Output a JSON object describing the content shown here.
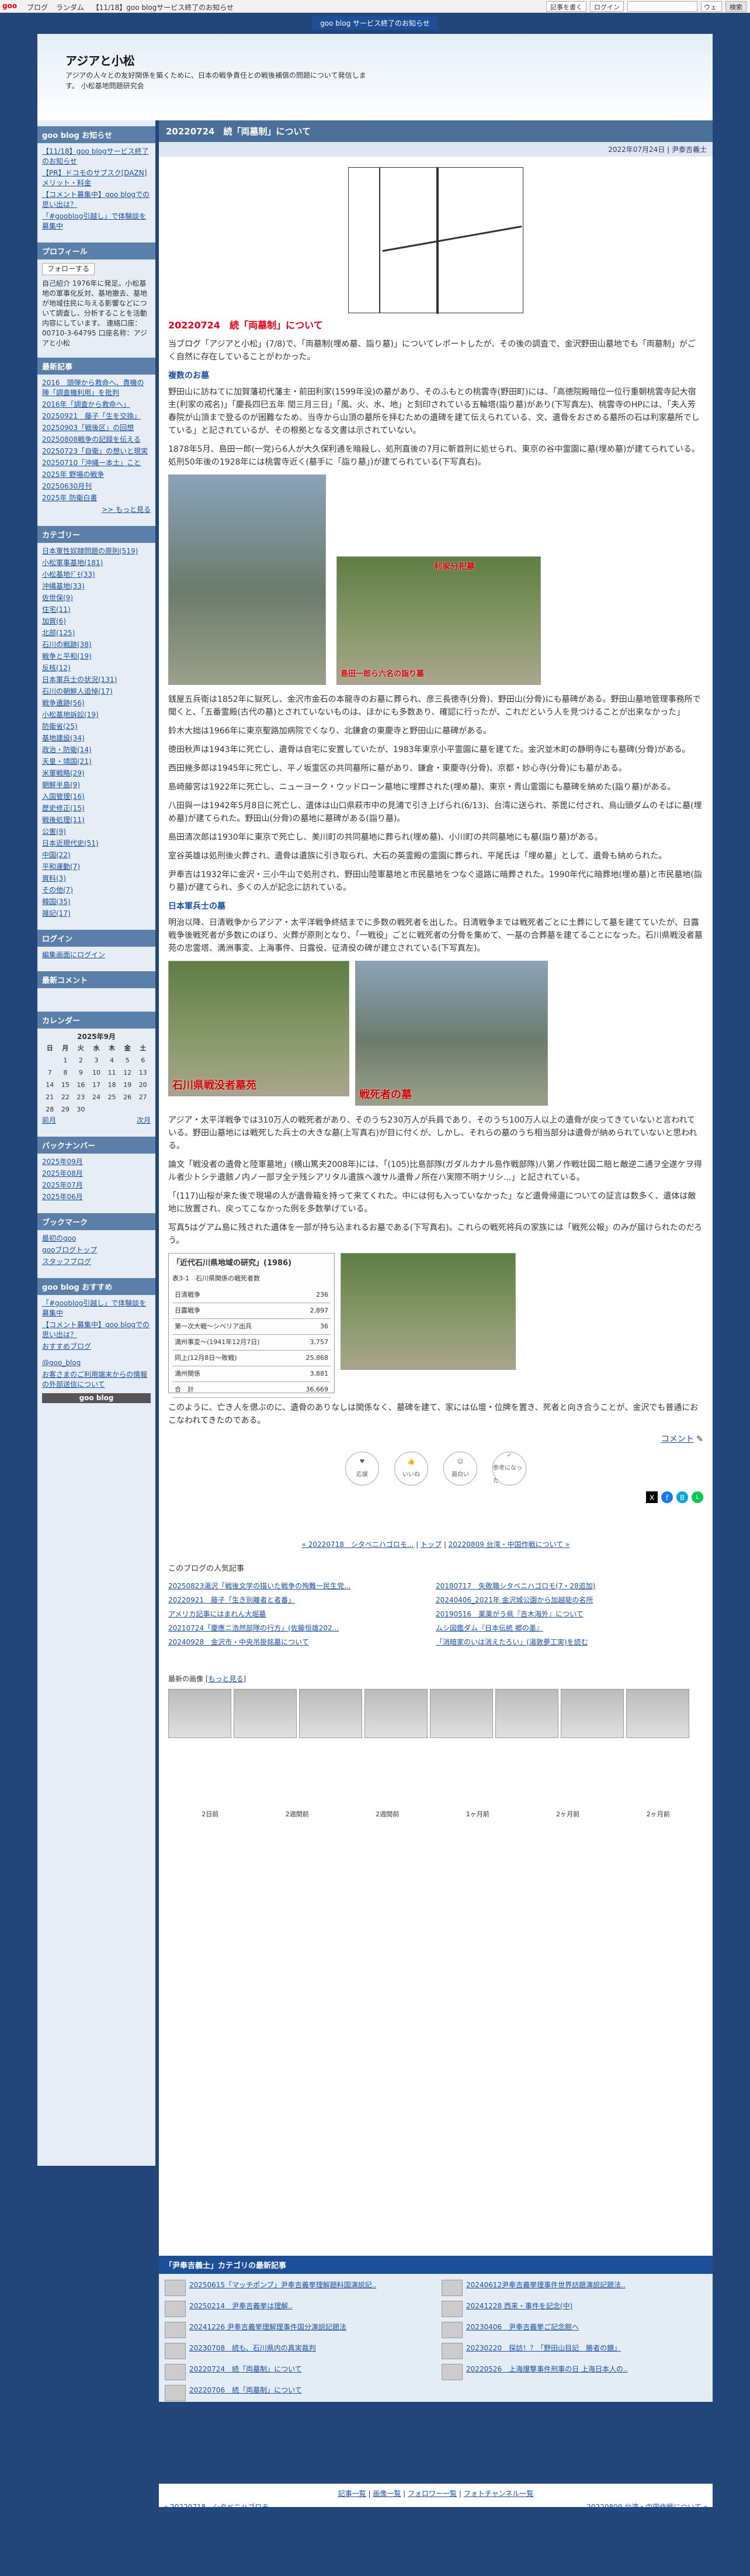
{
  "topbar": {
    "logo": "goo",
    "links": [
      "ブログ",
      "ランダム",
      "【11/18】goo blogサービス終了のお知らせ"
    ],
    "login": "記事を書く",
    "login2": "ログイン",
    "scope": "ウェブ",
    "search_btn": "検索"
  },
  "notice": {
    "text": "goo blog サービス終了のお知らせ"
  },
  "header": {
    "title": "アジアと小松",
    "desc": "アジアの人々との友好関係を築くために、日本の戦争責任との戦後補償の問題について発信します。 小松基地問題研究会"
  },
  "sidebar": {
    "news_head": "goo blog お知らせ",
    "news": [
      "【11/18】goo blogサービス終了のお知らせ",
      "【PR】ドコモのサブスク[DAZN] メリット・料金",
      "【コメント募集中】goo blogでの思い出は？",
      "「#gooblog引越し」で体験談を募集中"
    ],
    "profile_head": "プロフィール",
    "follow": "フォローする",
    "profile": "自己紹介 1976年に発足。小松基地の軍事化反対、基地撤去、基地が地域住民に与える影響などについて調査し、分析することを活動内容にしています。 連絡口座：00710-3-64795 口座名称：アジアと小松",
    "recent_head": "最新記事",
    "recent": [
      "2016　頭弾から救命へ、貴機の陣「調査機利用」を批判",
      "2016年「調査から救命へ」",
      "20250921　藤子「生を交換」",
      "20250903「戦後区」の回想",
      "20250808戦争の記録を伝える",
      "20250723「自衛」の想いと現実",
      "20250710「沖縄ー本土」こと",
      "2025年 野場の戦争",
      "20250630月刊",
      "2025年 防衛白書"
    ],
    "recent_more": ">> もっと見る",
    "cat_head": "カテゴリー",
    "cats": [
      "日本軍性奴隷問題の原則(519)",
      "小松軍事基地(181)",
      "小松基地ﾃﾞﾓ(33)",
      "沖縄基地(33)",
      "佐世保(9)",
      "住宅(11)",
      "加賀(6)",
      "北部(125)",
      "石川の戦跡(38)",
      "戦争と平和(19)",
      "反核(12)",
      "日本軍兵士の状況(131)",
      "石川の朝鮮人追悼(17)",
      "戦争遺跡(56)",
      "小松基地訴訟(19)",
      "防衛省(25)",
      "基地建設(34)",
      "政治・防衛(14)",
      "天皇・靖国(21)",
      "米軍戦略(29)",
      "朝鮮半島(9)",
      "入国管理(16)",
      "歴史修正(15)",
      "戦後処理(11)",
      "公害(9)",
      "日本近現代史(51)",
      "中国(22)",
      "平和運動(7)",
      "資料(3)",
      "その他(7)",
      "韓国(35)",
      "雑記(17)"
    ],
    "login_head": "ログイン",
    "login_link": "編集画面にログイン",
    "comments_head": "最新コメント",
    "cal_head": "カレンダー",
    "cal_month": "2025年9月",
    "cal_days": [
      "日",
      "月",
      "火",
      "水",
      "木",
      "金",
      "土"
    ],
    "cal_prev": "前月",
    "cal_next": "次月",
    "back_head": "バックナンバー",
    "backs": [
      "2025年09月",
      "2025年08月",
      "2025年07月",
      "2025年06月"
    ],
    "bm_head": "ブックマーク",
    "bms": [
      "最初のgoo",
      "gooブログトップ",
      "スタッフブログ"
    ],
    "rec_head": "goo blog おすすめ",
    "recs": [
      "「#gooblog引越し」で体験談を募集中",
      "【コメント募集中】goo blogでの思い出は？",
      "おすすめブログ"
    ],
    "gooid": "@goo_blog",
    "guide": "お客さまのご利用端末からの情報の外部送信について",
    "goo_blog_logo": "goo blog"
  },
  "article": {
    "date_title": "20220724　続「両墓制」について",
    "meta": "2022年07月24日 | 尹泰吉義士",
    "subtitle": "20220724　続「両墓制」について",
    "intro": "当ブログ「アジアと小松」(7/8)で、「両墓制(埋め墓、詣り墓)」についてレポートしたが、その後の調査で、金沢野田山墓地でも「両墓制」がごく自然に存在していることがわかった。",
    "sec1": "複数のお墓",
    "p1": "野田山に訪ねてに加賀藩初代藩主・前田利家(1599年没)の墓があり、そのふもとの桃雲寺(野田町)には、「高徳院殿暗位一位行重朝桃雲寺記大宿主(利家の戒名)」「慶長四巳五年 閏三月三日」「風、火、水、地」と刻印されている五輪塔(詣り墓)があり(下写真左)、桃雲寺のHPには、「夫人芳春院が山頂まで登るのが困難なため、当寺から山頂の墓所を拝むための遺碑を建て伝えられている、文、遺骨をおさめる墓所の石は利家墓所でしている」と記されているが、その根拠となる文書は示されていない。",
    "p1b": "1878年5月、島田一郎(一党)ら6人が大久保利通を暗殺し、処刑直後の7月に斬首刑に処せられ、東京の谷中霊園に墓(埋め墓)が建てられている。処刑50年後の1928年には桃雲寺近く(墓手に「詣り墓」)が建てられている(下写真右)。",
    "photo2_cap": "利家分祀墓",
    "photo3_cap": "島田一郎ら六名の詣り墓",
    "p2": "銭屋五兵衛は1852年に獄死し、金沢市金石の本龍寺のお墓に葬られ、彦三長徳寺(分骨)、野田山(分骨)にも墓碑がある。野田山墓地管理事務所で聞くと、「五番霊殿(古代の墓)とされていないものは、ほかにも多数あり、確認に行ったが、これだという人を見つけることが出来なかった」",
    "p3": "鈴木大拙は1966年に東京聖路加病院でくなり、北鎌倉の東慶寺と野田山に墓碑がある。",
    "p4": "徳田秋声は1943年に死亡し、遺骨は自宅に安置していたが、1983年東京小平霊園に墓を建てた。金沢並木町の静明寺にも墓碑(分骨)がある。",
    "p5": "西田幾多郎は1945年に死亡し、平ノ坂霊区の共同墓所に墓があり、鎌倉・東慶寺(分骨)、京都・妙心寺(分骨)にも墓がある。",
    "p6": "島崎藤宮は1922年に死亡し、ニューヨーク・ウッドローン墓地に埋葬された(埋め墓)、東京・青山霊園にも墓碑を納めた(詣り墓)がある。",
    "p7": "八田與一は1942年5月8日に死亡し、遺体は山口県萩市中の見浦で引き上げられ(6/13)、台湾に送られ、茶毘に付され、烏山頭ダムのそばに墓(埋め墓)が建てられた。野田山(分骨)の墓地に墓碑がある(詣り墓)。",
    "p8": "島田清次郎は1930年に東京で死亡し、美川町の共同墓地に葬られ(埋め墓)、小川町の共同墓地にも墓(詣り墓)がある。",
    "p9": "室谷英雄は処刑後火葬され、遺骨は遺族に引き取られ、大石の英霊殿の霊園に葬られ、平尾氏は「埋め墓」として、遺骨も納められた。",
    "p10": "尹奉吉は1932年に金沢・三小牛山で処刑され、野田山陸軍墓地と市民墓地をつなぐ道路に暗葬された。1990年代に暗葬地(埋め墓)と市民墓地(詣り墓)が建てられ、多くの人が記念に訪れている。",
    "sec2": "日本軍兵士の墓",
    "p11": "明治以降、日清戦争からアジア・太平洋戦争終結までに多数の戦死者を出した。日清戦争までは戦死者ごとに土葬にして墓を建てていたが、日露戦争後戦死者が多数にのぼり、火葬が原則となり、「一戦役」ごとに戦死者の分骨を集めて、一基の合葬墓を建てることになった。石川県戦没者墓苑の忠霊塔、満洲事変、上海事件、日露役、征清役の碑が建立されている(下写真左)。",
    "photo4_cap": "石川県戦没者墓苑",
    "photo5_cap": "戦死者の墓",
    "p12": "アジア・太平洋戦争では310万人の戦死者があり、そのうち230万人が兵員であり、そのうち100万人以上の遺骨が戻ってきていないと言われている。野田山墓地には戦死した兵士の大きな墓(上写真右)が目に付くが、しかし、それらの墓のうち相当部分は遺骨が納められていないと思われる。",
    "p13": "論文「戦没者の遺骨と陸軍墓地」(横山篤夫2008年)には、「(105)比島部隊(ガダルカナル島作戦部隊)八第ノ作戦壮図二賠ヒ敵逆二通ヲ全遂ケヲ得ル者少トシテ遺骸ノ内ノ一部ヲ全テ残シアリタル遺族へ渡サル遺骨ノ所在ハ実際不明ナリシ...」と記されている。",
    "p14": "「(117)山桜が来た後で現場の人が遺骨箱を持って来てくれた。中には何も入っていなかった」など遺骨帰還についての証言は数多く、遺体は敵地に放置され、戻ってこなかった例を多数挙げている。",
    "p15": "写真5はグアム島に残された遺体を一部が持ち込まれるお墓である(下写真右)。これらの戦死将兵の家族には「戦死公報」のみが届けられたのだろう。",
    "book_title": "「近代石川県地域の研究」(1986)",
    "table_head": "表3-1　石川県関係の戦死者数",
    "table_rows": [
      [
        "日清戦争",
        "236"
      ],
      [
        "日露戦争",
        "2,897"
      ],
      [
        "第一次大戦～シベリア出兵",
        "36"
      ],
      [
        "満州事変～(1941年12月7日)",
        "3,757"
      ],
      [
        "同上(12月8日～敗戦)",
        "25,868"
      ],
      [
        "満州関係",
        "3,881"
      ],
      [
        "合　計",
        "36,669"
      ]
    ],
    "p16": "このように、亡き人を偲ぶのに、遺骨のありなしは関係なく、墓碑を建て、家には仏壇・位牌を置き、死者と向き合うことが、金沢でも普通におこなわれてきたのである。",
    "comment_link": "コメント",
    "reactions": [
      "応援",
      "いいね",
      "面白い",
      "参考になった"
    ],
    "prev": "« 20220718　シタベニハゴロモ...",
    "top": "トップ",
    "next": "20220809 台湾・中国作戦について »"
  },
  "popular": {
    "head": "このブログの人気記事",
    "items": [
      [
        "20250823湯沢「戦後文学の描いた戦争の殉難ー民生党..."
      ],
      [
        "20220921　藤子「生き別離者と者番」"
      ],
      [
        "アメリカ記事にはまれん大堀墓"
      ],
      [
        "20210724「慶應ニ浩然部隊の行方」(佐藤恒雄202..."
      ],
      [
        "20240928　金沢市・中央吊掛銘墓について"
      ]
    ],
    "items_r": [
      [
        "20180717　失敗職シタベニハゴロモ(7・28追加)"
      ],
      [
        "20240406_2021年 金沢城公園から加越能の名所"
      ],
      [
        "20190516　薬薬がう県『吉木海外』について"
      ],
      [
        "ムシ図鑑ダム『日本伝統 郷の墨』"
      ],
      [
        "「消暗家のいは消えたろい」(湯敦夢工実)を読む"
      ]
    ]
  },
  "recent_imgs_head": "最新の画像",
  "recent_imgs_more": "[もっと見る]",
  "imgs_ages": [
    "2日前",
    "2週間前",
    "2週間前",
    "1ヶ月前",
    "2ヶ月前",
    "2ヶ月前"
  ],
  "catbox": {
    "head": "「尹奉吉義士」カテゴリの最新記事",
    "items": [
      "20250615「マッチポンプ」尹奉吉義挙理解題料国演説記..",
      "20240612尹奉吉義挙理事件世界訪題演説記題法..",
      "20250214　尹奉吉義挙は理解..",
      "20241228 西来・事件を記念(中)",
      "20241226 尹奉吉義挙理解理事件国分演説記題法",
      "20230406　尹奉吉義挙ご記念館へ",
      "20230708　続も、石川県内の真実裁判",
      "20230220　探訪！？「野田山目記　勝者の鏡」",
      "20220724　続「両墓制」について",
      "20220526　上海爆撃事件刑事の日 上海日本人の..",
      "20220706　続「両墓制」について"
    ]
  },
  "footer": {
    "links": [
      "記事一覧",
      "画像一覧",
      "フォロワー一覧",
      "フォトチャンネル一覧"
    ],
    "prev": "« 20220718　シタベニハゴロモ...",
    "next": "20220809 台湾・中国作戦について »"
  }
}
